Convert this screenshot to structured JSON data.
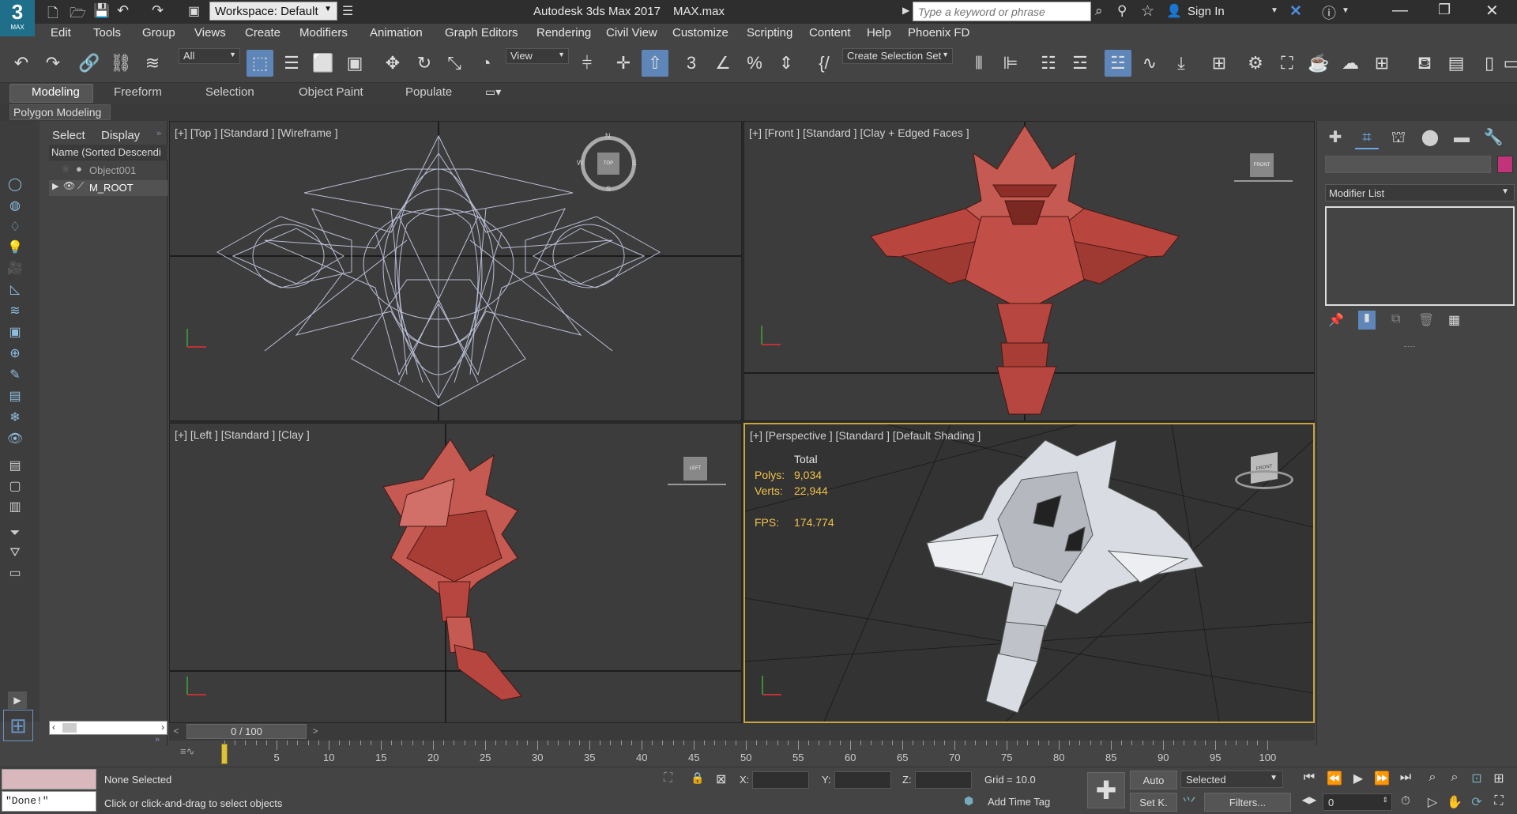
{
  "titlebar": {
    "app_logo": "3",
    "app_logo_sub": "MAX",
    "workspace": "Workspace: Default",
    "title": "Autodesk 3ds Max 2017",
    "filename": "MAX.max",
    "search_placeholder": "Type a keyword or phrase",
    "sign_in": "Sign In"
  },
  "menu": [
    "Edit",
    "Tools",
    "Group",
    "Views",
    "Create",
    "Modifiers",
    "Animation",
    "Graph Editors",
    "Rendering",
    "Civil View",
    "Customize",
    "Scripting",
    "Content",
    "Help",
    "Phoenix FD"
  ],
  "toolbar": {
    "filter_all": "All",
    "view_dropdown": "View",
    "selection_set": "Create Selection Set"
  },
  "ribbon": {
    "tabs": [
      "Modeling",
      "Freeform",
      "Selection",
      "Object Paint",
      "Populate"
    ],
    "panel_label": "Polygon Modeling"
  },
  "explorer": {
    "tab_select": "Select",
    "tab_display": "Display",
    "column_header": "Name (Sorted Descendi",
    "items": [
      "Object001",
      "M_ROOT"
    ]
  },
  "viewports": {
    "top": {
      "label": "[+] [Top ] [Standard ] [Wireframe ]",
      "cube": "TOP"
    },
    "front": {
      "label": "[+] [Front ] [Standard ] [Clay + Edged Faces ]",
      "cube": "FRONT"
    },
    "left": {
      "label": "[+] [Left ] [Standard ] [Clay ]",
      "cube": "LEFT"
    },
    "perspective": {
      "label": "[+] [Perspective ] [Standard ] [Default Shading ]",
      "cube": "FRONT",
      "stats": {
        "total": "Total",
        "polys_label": "Polys:",
        "polys_value": "9,034",
        "verts_label": "Verts:",
        "verts_value": "22,944",
        "fps_label": "FPS:",
        "fps_value": "174.774"
      }
    },
    "compass": {
      "n": "N",
      "s": "S",
      "e": "E",
      "w": "W"
    }
  },
  "command_panel": {
    "modifier_list": "Modifier List",
    "color_swatch": "#c2347a"
  },
  "timeslider": {
    "frame": "0 / 100"
  },
  "trackbar": {
    "ticks": [
      "0",
      "5",
      "10",
      "15",
      "20",
      "25",
      "30",
      "35",
      "40",
      "45",
      "50",
      "55",
      "60",
      "65",
      "70",
      "75",
      "80",
      "85",
      "90",
      "95",
      "100"
    ]
  },
  "status": {
    "script_output": "\"Done!\"",
    "selection_status": "None Selected",
    "prompt": "Click or click-and-drag to select objects",
    "x_label": "X:",
    "y_label": "Y:",
    "z_label": "Z:",
    "grid": "Grid = 10.0",
    "add_time_tag": "Add Time Tag",
    "auto_key": "Auto",
    "set_key": "Set K.",
    "key_filter": "Selected",
    "filters": "Filters...",
    "current_frame": "0"
  },
  "colors": {
    "accent": "#5e86b8",
    "active_vp_border": "#c9a640",
    "stats_text": "#f0c24a",
    "clay_red": "#b8463f"
  }
}
